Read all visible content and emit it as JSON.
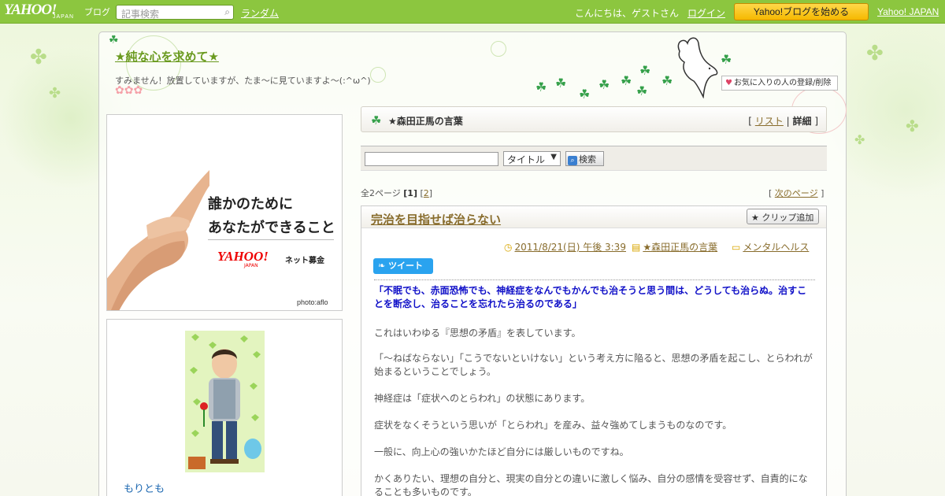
{
  "topbar": {
    "logo": "YAHOO!",
    "logo_sub": "JAPAN",
    "logo_blog": "ブログ",
    "search_placeholder": "記事検索",
    "random": "ランダム",
    "greeting": "こんにちは、ゲストさん",
    "login": "ログイン",
    "start_blog": "Yahoo!ブログを始める",
    "yahoo_japan": "Yahoo! JAPAN"
  },
  "blog": {
    "title": "★純な心を求めて★",
    "description": "すみません！放置していますが、たま～に見ていますよ～(:^ω^)",
    "favorite_button": "お気に入りの人の登録/削除"
  },
  "banner": {
    "line1": "誰かのために",
    "line2": "あなたができること",
    "yahoo": "YAHOO!",
    "yahoo_sub": "JAPAN",
    "net": "ネット募金",
    "photo": "photo:aflo"
  },
  "profile": {
    "name": "もりとも"
  },
  "theme": {
    "title": "★森田正馬の言葉",
    "list": "リスト",
    "detail": "詳細"
  },
  "search": {
    "select_value": "タイトル",
    "button": "検索"
  },
  "pager": {
    "total": "全2ページ",
    "page1": "[1]",
    "page2": "2",
    "next": "次のページ"
  },
  "article": {
    "title": "完治を目指せば治らない",
    "clip": "クリップ追加",
    "date": "2011/8/21(日) 午後 3:39",
    "theme": "★森田正馬の言葉",
    "category": "メンタルヘルス",
    "tweet": "ツイート",
    "quote": "「不眠でも、赤面恐怖でも、神経症をなんでもかんでも治そうと思う間は、どうしても治らぬ。治すことを断念し、治ることを忘れたら治るのである」",
    "paragraphs": [
      "これはいわゆる『思想の矛盾』を表しています。",
      "「～ねばならない」「こうでないといけない」という考え方に陥ると、思想の矛盾を起こし、とらわれが始まるということでしょう。",
      "神経症は「症状へのとらわれ」の状態にあります。",
      "症状をなくそうという思いが「とらわれ」を産み、益々強めてしまうものなのです。",
      "一般に、向上心の強いかたほど自分には厳しいものですね。",
      "かくありたい、理想の自分と、現実の自分との違いに激しく悩み、自分の感情を受容せず、自責的になることも多いものです。"
    ]
  },
  "colors": {
    "topbar": "#8cc63f",
    "accent_link": "#886c2c",
    "quote": "#1010c8",
    "start_button": "#f5b800"
  }
}
